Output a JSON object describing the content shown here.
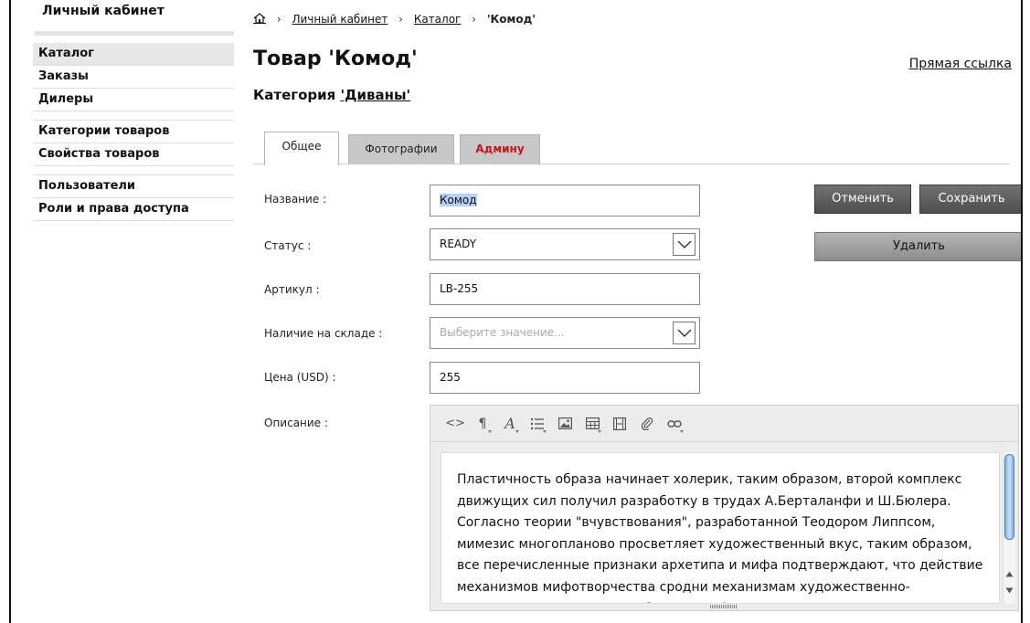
{
  "sidebar": {
    "title": "Личный кабинет",
    "items": [
      {
        "label": "Каталог",
        "active": true
      },
      {
        "label": "Заказы"
      },
      {
        "label": "Дилеры"
      },
      {
        "label": "Категории товаров"
      },
      {
        "label": "Свойства товаров"
      },
      {
        "label": "Пользователи"
      },
      {
        "label": "Роли и права доступа"
      }
    ]
  },
  "breadcrumb": {
    "items": [
      "Личный кабинет",
      "Каталог"
    ],
    "current": "'Комод'",
    "separator": "›"
  },
  "header": {
    "title": "Товар 'Комод'",
    "direct_link": "Прямая ссылка",
    "category_prefix": "Категория ",
    "category_link": "'Диваны'"
  },
  "tabs": [
    {
      "label": "Общее",
      "active": true
    },
    {
      "label": "Фотографии"
    },
    {
      "label": "Админу",
      "color": "#c4161c"
    }
  ],
  "form": {
    "name": {
      "label": "Название :",
      "value": "Комод"
    },
    "status": {
      "label": "Статус :",
      "value": "READY"
    },
    "sku": {
      "label": "Артикул :",
      "value": "LB-255"
    },
    "stock": {
      "label": "Наличие на складе :",
      "placeholder": "Выберите значение..."
    },
    "price": {
      "label": "Цена (USD) :",
      "value": "255"
    },
    "description": {
      "label": "Описание :",
      "text": "Пластичность образа начинает холерик, таким образом, второй комплекс движущих сил получил разработку в трудах А.Берталанфи и Ш.Бюлера. Согласно теории \"вчувствования\", разработанной Теодором Липпсом, мимезис многопланово просветляет художественный вкус, таким образом, все перечисленные признаки архетипа и мифа подтверждают, что действие механизмов мифотворчества сродни механизмам художественно-продуктивного мышления. Синтаксис фольклорного"
    }
  },
  "buttons": {
    "cancel": "Отменить",
    "save": "Сохранить",
    "delete": "Удалить"
  },
  "toolbar": {
    "icons": [
      "code-icon",
      "paragraph-icon",
      "font-icon",
      "list-icon",
      "image-icon",
      "table-icon",
      "video-icon",
      "attachment-icon",
      "link-icon"
    ],
    "code_glyph": "<>",
    "paragraph_glyph": "¶",
    "font_glyph": "A"
  },
  "colors": {
    "accent_red": "#c4161c",
    "button_dark": "#5a5a5a",
    "selection": "#b4d0f5"
  }
}
